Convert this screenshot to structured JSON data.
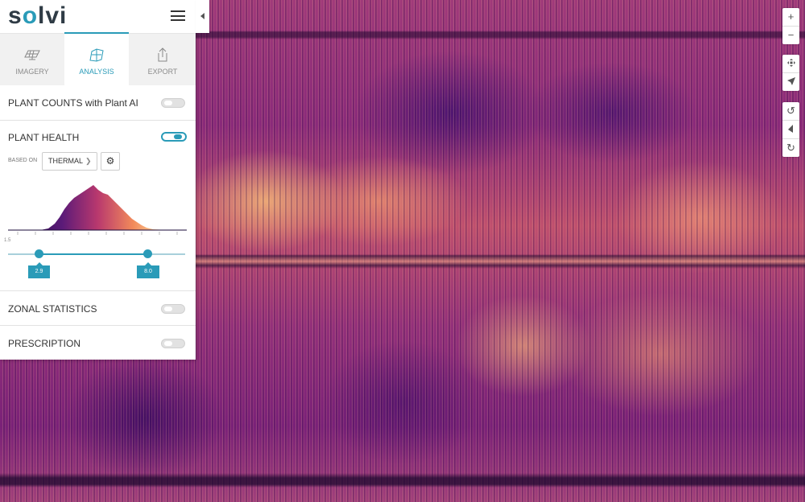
{
  "app": {
    "logo_text": "solvi"
  },
  "tabs": [
    {
      "label": "IMAGERY",
      "icon": "solar-panel-icon"
    },
    {
      "label": "ANALYSIS",
      "icon": "map-layers-icon"
    },
    {
      "label": "EXPORT",
      "icon": "export-icon"
    }
  ],
  "active_tab": "ANALYSIS",
  "sections": {
    "plant_counts": {
      "title": "PLANT COUNTS with Plant AI",
      "enabled": false
    },
    "plant_health": {
      "title": "PLANT HEALTH",
      "enabled": true,
      "based_on_label": "BASED ON",
      "based_on_value": "THERMAL",
      "histogram_min_label": "1.5",
      "range_low": "2.9",
      "range_high": "8.0"
    },
    "zonal_statistics": {
      "title": "ZONAL STATISTICS",
      "enabled": false
    },
    "prescription": {
      "title": "PRESCRIPTION",
      "enabled": false
    }
  },
  "map_controls": {
    "zoom": [
      "+",
      "−"
    ],
    "navigation": [
      "pan-icon",
      "locate-arrow-icon"
    ],
    "rotation": [
      "rotate-left-icon",
      "compass-icon",
      "rotate-right-icon"
    ]
  },
  "colors": {
    "accent": "#2a9bb8",
    "heatmap": [
      "#2b0b5a",
      "#8a2a7a",
      "#d9566a",
      "#f7a45c",
      "#fde7c0"
    ]
  }
}
